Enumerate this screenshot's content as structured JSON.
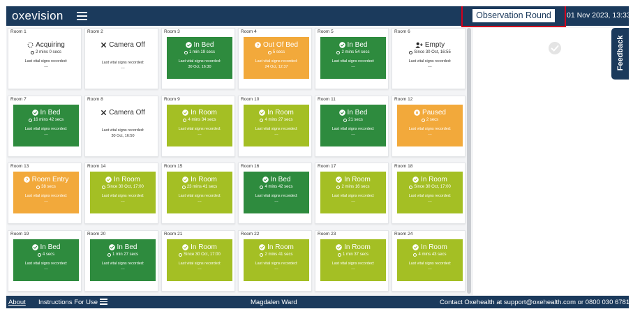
{
  "header": {
    "logo": "oxevision",
    "observation_button": "Observation Round",
    "datetime": "01 Nov 2023, 13:33"
  },
  "vital_label": "Last vital signs recorded:",
  "colors": {
    "navy": "#1b3a5c",
    "dark_green": "#2e8b3e",
    "lime_green": "#a4bf24",
    "orange": "#f2a93b",
    "white": "#ffffff",
    "highlight_red": "#d2001d"
  },
  "rooms": [
    {
      "label": "Room 1",
      "status": "Acquiring",
      "icon": "spinner-icon",
      "color": "white",
      "time": "2 mins 0 secs",
      "vital": "---"
    },
    {
      "label": "Room 2",
      "status": "Camera Off",
      "icon": "x-icon",
      "color": "white",
      "time": "",
      "vital": "---"
    },
    {
      "label": "Room 3",
      "status": "In Bed",
      "icon": "check-circle-icon",
      "color": "dark_green",
      "time": "1 min 19 secs",
      "vital": "30 Oct, 16:30"
    },
    {
      "label": "Room 4",
      "status": "Out Of Bed",
      "icon": "question-circle-icon",
      "color": "orange",
      "time": "5 secs",
      "vital": "24 Oct, 12:37"
    },
    {
      "label": "Room 5",
      "status": "In Bed",
      "icon": "check-circle-icon",
      "color": "dark_green",
      "time": "2 mins 54 secs",
      "vital": "---"
    },
    {
      "label": "Room 6",
      "status": "Empty",
      "icon": "user-plus-icon",
      "color": "white",
      "time": "Since 30 Oct, 16:55",
      "vital": "---"
    },
    {
      "label": "Room 7",
      "status": "In Bed",
      "icon": "check-circle-icon",
      "color": "dark_green",
      "time": "16 mins 42 secs",
      "vital": "---"
    },
    {
      "label": "Room 8",
      "status": "Camera Off",
      "icon": "x-icon",
      "color": "white",
      "time": "",
      "vital": "30 Oct, 16:50"
    },
    {
      "label": "Room 9",
      "status": "In Room",
      "icon": "check-circle-icon",
      "color": "lime_green",
      "time": "4 mins 34 secs",
      "vital": "---"
    },
    {
      "label": "Room 10",
      "status": "In Room",
      "icon": "check-circle-icon",
      "color": "lime_green",
      "time": "4 mins 27 secs",
      "vital": "---"
    },
    {
      "label": "Room 11",
      "status": "In Bed",
      "icon": "check-circle-icon",
      "color": "dark_green",
      "time": "21 secs",
      "vital": "---"
    },
    {
      "label": "Room 12",
      "status": "Paused",
      "icon": "pause-circle-icon",
      "color": "orange",
      "time": "2 secs",
      "vital": "---"
    },
    {
      "label": "Room 13",
      "status": "Room Entry",
      "icon": "question-circle-icon",
      "color": "orange",
      "time": "38 secs",
      "vital": "---"
    },
    {
      "label": "Room 14",
      "status": "In Room",
      "icon": "check-circle-icon",
      "color": "lime_green",
      "time": "Since 30 Oct, 17:00",
      "vital": "---"
    },
    {
      "label": "Room 15",
      "status": "In Room",
      "icon": "check-circle-icon",
      "color": "lime_green",
      "time": "23 mins 41 secs",
      "vital": "---"
    },
    {
      "label": "Room 16",
      "status": "In Bed",
      "icon": "check-circle-icon",
      "color": "dark_green",
      "time": "4 mins 42 secs",
      "vital": "---"
    },
    {
      "label": "Room 17",
      "status": "In Room",
      "icon": "check-circle-icon",
      "color": "lime_green",
      "time": "2 mins 16 secs",
      "vital": "---"
    },
    {
      "label": "Room 18",
      "status": "In Room",
      "icon": "check-circle-icon",
      "color": "lime_green",
      "time": "Since 30 Oct, 17:00",
      "vital": "---"
    },
    {
      "label": "Room 19",
      "status": "In Bed",
      "icon": "check-circle-icon",
      "color": "dark_green",
      "time": "4 secs",
      "vital": "---"
    },
    {
      "label": "Room 20",
      "status": "In Bed",
      "icon": "check-circle-icon",
      "color": "dark_green",
      "time": "1 min 27 secs",
      "vital": "---"
    },
    {
      "label": "Room 21",
      "status": "In Room",
      "icon": "check-circle-icon",
      "color": "lime_green",
      "time": "Since 30 Oct, 17:00",
      "vital": "---"
    },
    {
      "label": "Room 22",
      "status": "In Room",
      "icon": "check-circle-icon",
      "color": "lime_green",
      "time": "2 mins 41 secs",
      "vital": "---"
    },
    {
      "label": "Room 23",
      "status": "In Room",
      "icon": "check-circle-icon",
      "color": "lime_green",
      "time": "1 min 37 secs",
      "vital": "---"
    },
    {
      "label": "Room 24",
      "status": "In Room",
      "icon": "check-circle-icon",
      "color": "lime_green",
      "time": "4 mins 43 secs",
      "vital": "---"
    }
  ],
  "side": {
    "feedback_label": "Feedback"
  },
  "footer": {
    "about": "About",
    "instructions": "Instructions For Use",
    "ward": "Magdalen Ward",
    "contact": "Contact Oxehealth at support@oxehealth.com or 0800 030 6781"
  }
}
